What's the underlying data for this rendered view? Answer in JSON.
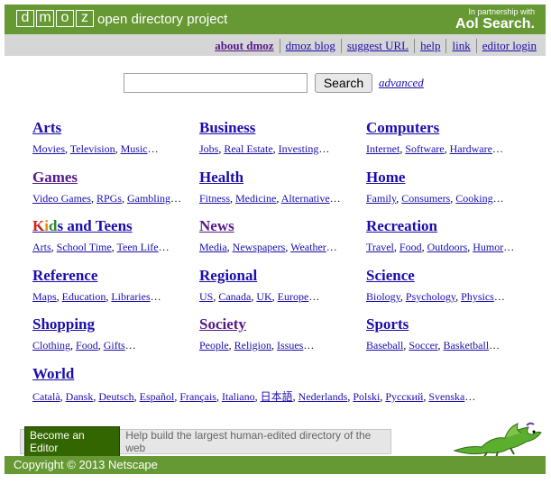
{
  "header": {
    "logo_letters": [
      "d",
      "m",
      "o",
      "z"
    ],
    "tagline": "open directory project",
    "partner_small": "In partnership with",
    "partner_brand": "Aol Search."
  },
  "nav": {
    "links": [
      "about dmoz",
      "dmoz blog",
      "suggest URL",
      "help",
      "link",
      "editor login"
    ]
  },
  "search": {
    "button_label": "Search",
    "advanced_label": "advanced",
    "query_value": ""
  },
  "categories": [
    {
      "title": "Arts",
      "subs": [
        "Movies",
        "Television",
        "Music"
      ]
    },
    {
      "title": "Business",
      "subs": [
        "Jobs",
        "Real Estate",
        "Investing"
      ]
    },
    {
      "title": "Computers",
      "subs": [
        "Internet",
        "Software",
        "Hardware"
      ]
    },
    {
      "title": "Games",
      "subs": [
        "Video Games",
        "RPGs",
        "Gambling"
      ]
    },
    {
      "title": "Health",
      "subs": [
        "Fitness",
        "Medicine",
        "Alternative"
      ]
    },
    {
      "title": "Home",
      "subs": [
        "Family",
        "Consumers",
        "Cooking"
      ]
    },
    {
      "title": "Kids and Teens",
      "subs": [
        "Arts",
        "School Time",
        "Teen Life"
      ]
    },
    {
      "title": "News",
      "subs": [
        "Media",
        "Newspapers",
        "Weather"
      ]
    },
    {
      "title": "Recreation",
      "subs": [
        "Travel",
        "Food",
        "Outdoors",
        "Humor"
      ]
    },
    {
      "title": "Reference",
      "subs": [
        "Maps",
        "Education",
        "Libraries"
      ]
    },
    {
      "title": "Regional",
      "subs": [
        "US",
        "Canada",
        "UK",
        "Europe"
      ]
    },
    {
      "title": "Science",
      "subs": [
        "Biology",
        "Psychology",
        "Physics"
      ]
    },
    {
      "title": "Shopping",
      "subs": [
        "Clothing",
        "Food",
        "Gifts"
      ]
    },
    {
      "title": "Society",
      "subs": [
        "People",
        "Religion",
        "Issues"
      ]
    },
    {
      "title": "Sports",
      "subs": [
        "Baseball",
        "Soccer",
        "Basketball"
      ]
    },
    {
      "title": "World",
      "subs": [
        "Català",
        "Dansk",
        "Deutsch",
        "Español",
        "Français",
        "Italiano",
        "日本語",
        "Nederlands",
        "Polski",
        "Русский",
        "Svenska"
      ]
    }
  ],
  "editor": {
    "button_label": "Become an Editor",
    "text": "Help build the largest human-edited directory of the web"
  },
  "footer": {
    "copyright": "Copyright © 2013 Netscape"
  },
  "colors": {
    "brand_green": "#669933",
    "link_blue": "#1a0dab",
    "link_visited": "#551a8b"
  }
}
